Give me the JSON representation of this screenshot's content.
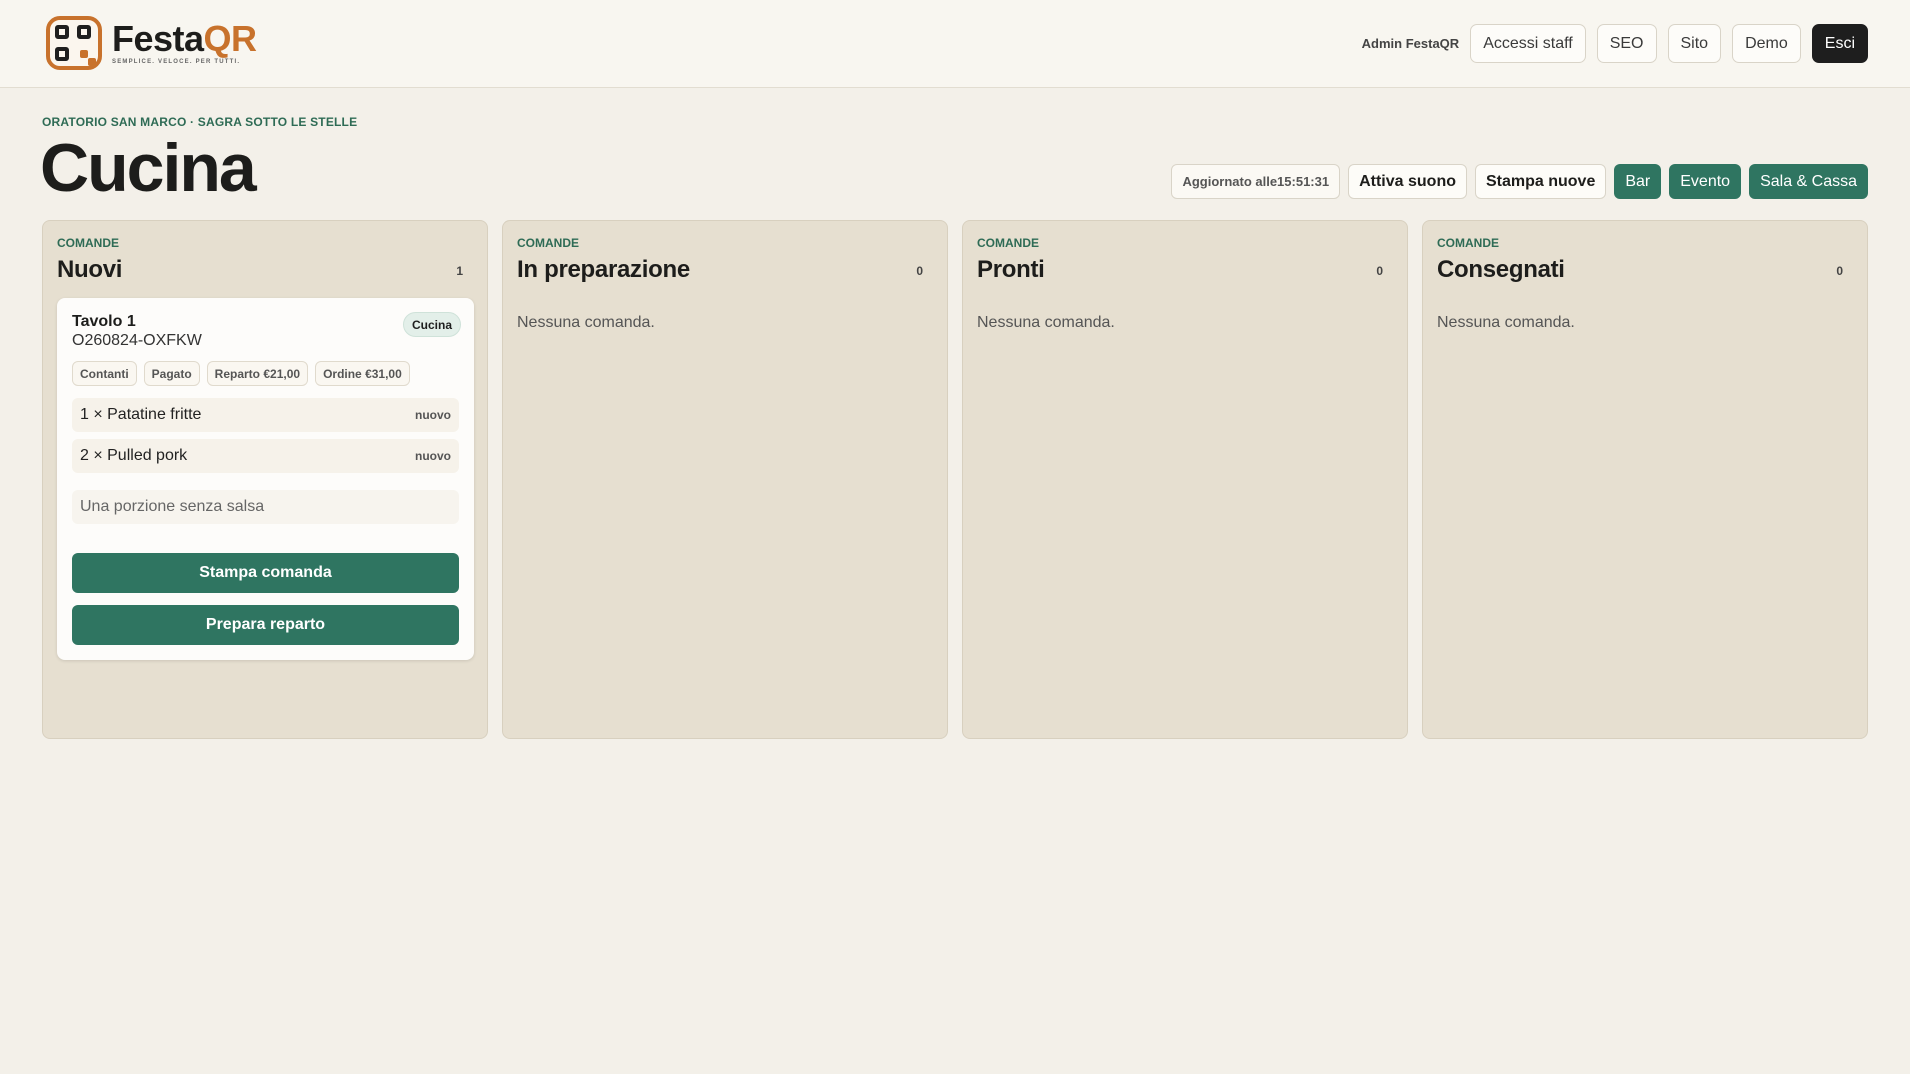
{
  "header": {
    "logo_name_a": "Festa",
    "logo_name_b": "QR",
    "logo_tagline": "SEMPLICE. VELOCE. PER TUTTI.",
    "admin_label": "Admin FestaQR",
    "nav": [
      "Accessi staff",
      "SEO",
      "Sito",
      "Demo",
      "Esci"
    ]
  },
  "page": {
    "eyebrow": "ORATORIO SAN MARCO · SAGRA SOTTO LE STELLE",
    "title": "Cucina"
  },
  "toolbar": {
    "updated": "Aggiornato alle15:51:31",
    "sound": "Attiva suono",
    "print_new": "Stampa nuove",
    "bar": "Bar",
    "event": "Evento",
    "hall": "Sala & Cassa"
  },
  "columns": [
    {
      "eyebrow": "COMANDE",
      "title": "Nuovi",
      "count": "1",
      "empty": ""
    },
    {
      "eyebrow": "COMANDE",
      "title": "In preparazione",
      "count": "0",
      "empty": "Nessuna comanda."
    },
    {
      "eyebrow": "COMANDE",
      "title": "Pronti",
      "count": "0",
      "empty": "Nessuna comanda."
    },
    {
      "eyebrow": "COMANDE",
      "title": "Consegnati",
      "count": "0",
      "empty": "Nessuna comanda."
    }
  ],
  "order": {
    "table": "Tavolo 1",
    "code": "O260824-OXFKW",
    "badge": "Cucina",
    "tags": [
      "Contanti",
      "Pagato",
      "Reparto €21,00",
      "Ordine €31,00"
    ],
    "items": [
      {
        "label": "1 × Patatine fritte",
        "status": "nuovo"
      },
      {
        "label": "2 × Pulled pork",
        "status": "nuovo"
      }
    ],
    "note": "Una porzione senza salsa",
    "print_button": "Stampa comanda",
    "prepare_button": "Prepara reparto"
  },
  "colors": {
    "accent_green": "#2f7561",
    "brand_orange": "#c8722c",
    "column_bg": "#e6dfd0"
  }
}
